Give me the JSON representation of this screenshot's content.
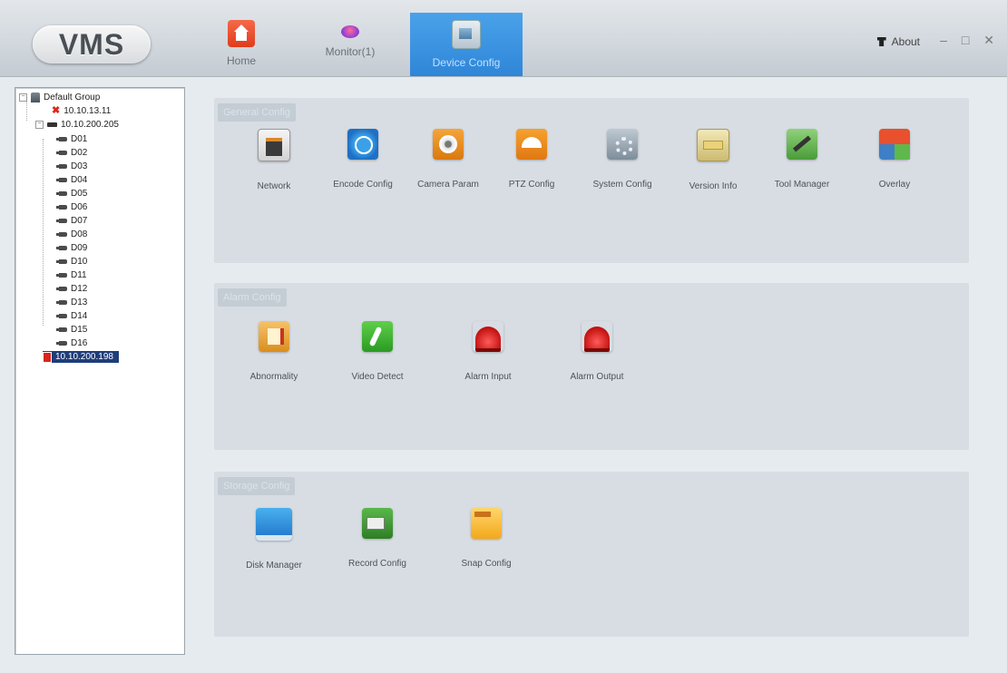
{
  "app": {
    "logo": "VMS"
  },
  "nav": {
    "tabs": [
      {
        "label": "Home",
        "icon": "home-icon"
      },
      {
        "label": "Monitor(1)",
        "icon": "monitor-icon"
      },
      {
        "label": "Device Config",
        "icon": "device-config-icon",
        "active": true
      }
    ]
  },
  "header": {
    "about": "About",
    "window_controls": "– □ ✕"
  },
  "tree": {
    "group": "Default Group",
    "devices": [
      {
        "ip": "10.10.13.11",
        "status": "offline"
      },
      {
        "ip": "10.10.200.205",
        "status": "online",
        "channels": [
          "D01",
          "D02",
          "D03",
          "D04",
          "D05",
          "D06",
          "D07",
          "D08",
          "D09",
          "D10",
          "D11",
          "D12",
          "D13",
          "D14",
          "D15",
          "D16"
        ]
      },
      {
        "ip": "10.10.200.198",
        "status": "selected"
      }
    ]
  },
  "panels": {
    "general": {
      "title": "General Config",
      "items": [
        "Network",
        "Encode Config",
        "Camera Param",
        "PTZ Config",
        "System Config",
        "Version Info",
        "Tool Manager",
        "Overlay"
      ]
    },
    "alarm": {
      "title": "Alarm Config",
      "items": [
        "Abnormality",
        "Video Detect",
        "Alarm Input",
        "Alarm Output"
      ]
    },
    "storage": {
      "title": "Storage Config",
      "items": [
        "Disk Manager",
        "Record Config",
        "Snap Config"
      ]
    }
  },
  "colors": {
    "active_tab": "#2f86d8",
    "selected_node": "#1f3d7a",
    "panel_bg": "#d7dde3"
  }
}
